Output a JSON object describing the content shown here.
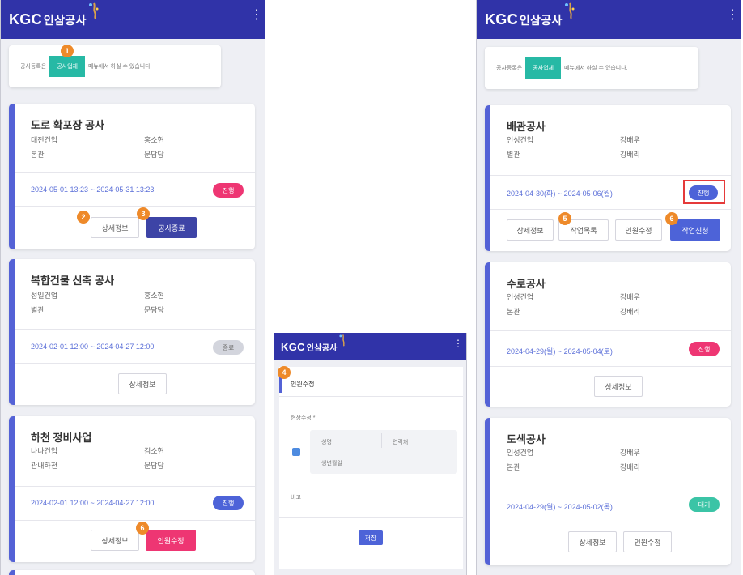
{
  "app": {
    "logo_main": "KGC",
    "logo_sub": "인삼공사",
    "menu_glyph": "⋮"
  },
  "notice": {
    "prefix": "공사등록은",
    "tag": "공사업체",
    "suffix": "메뉴에서 하실 수 있습니다."
  },
  "steps": [
    "1",
    "2",
    "3",
    "4",
    "5",
    "6"
  ],
  "screen1": {
    "cards": [
      {
        "title": "도로 확포장 공사",
        "company": "대전건업",
        "owner": "홍소현",
        "site": "본관",
        "manager": "문담당",
        "period": "2024-05-01 13:23 ~ 2024-05-31 13:23",
        "status": "진행",
        "buttons": [
          "상세정보",
          "공사종료"
        ]
      },
      {
        "title": "복합건물 신축 공사",
        "company": "성일건업",
        "owner": "홍소현",
        "site": "별관",
        "manager": "문담당",
        "period": "2024-02-01 12:00 ~ 2024-04-27 12:00",
        "status": "종료",
        "buttons": [
          "상세정보"
        ]
      },
      {
        "title": "하천 정비사업",
        "company": "나나건업",
        "owner": "김소현",
        "site": "관내하천",
        "manager": "문담당",
        "period": "2024-02-01 12:00 ~ 2024-04-27 12:00",
        "status": "진행",
        "buttons": [
          "상세정보",
          "인원수정"
        ]
      }
    ]
  },
  "screen2": {
    "tab": "인원수정",
    "label_workers": "현장수정 *",
    "ph_name": "성명",
    "ph_phone": "연락처",
    "ph_birth": "생년월일",
    "label_note": "비고",
    "save": "저장"
  },
  "screen3": {
    "cards": [
      {
        "title": "배관공사",
        "company": "인성건업",
        "owner": "강배우",
        "site": "별관",
        "manager": "강배리",
        "period": "2024-04-30(화) ~ 2024-05-06(월)",
        "status": "진행",
        "buttons": [
          "상세정보",
          "작업목록",
          "인원수정",
          "작업신청"
        ]
      },
      {
        "title": "수로공사",
        "company": "인성건업",
        "owner": "강배우",
        "site": "본관",
        "manager": "강배리",
        "period": "2024-04-29(월) ~ 2024-05-04(토)",
        "status": "진행",
        "buttons": [
          "상세정보"
        ]
      },
      {
        "title": "도색공사",
        "company": "인성건업",
        "owner": "강배우",
        "site": "본관",
        "manager": "강배리",
        "period": "2024-04-29(월) ~ 2024-05-02(목)",
        "status": "대기",
        "buttons": [
          "상세정보",
          "인원수정"
        ]
      }
    ]
  },
  "colors": {
    "appbar": "#3033a8",
    "accent": "#5462d6",
    "teal": "#27b9a5",
    "pink": "#ee3673",
    "step": "#ee8a2a",
    "highlight": "#e53a3a"
  }
}
